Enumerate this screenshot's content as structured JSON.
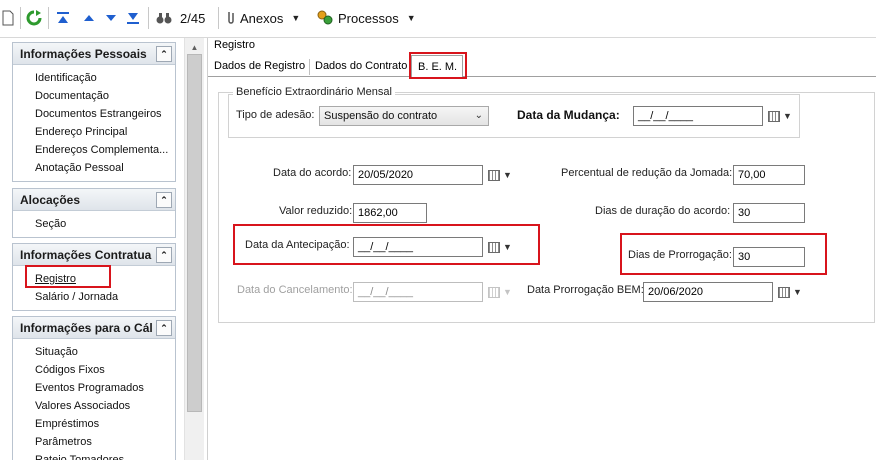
{
  "toolbar": {
    "counter": "2/45",
    "anexos_label": "Anexos",
    "processos_label": "Processos",
    "colors": {
      "green": "#2e9a2e",
      "blue": "#1f5fcf"
    }
  },
  "sidebar": {
    "sections": [
      {
        "title": "Informações Pessoais",
        "items": [
          "Identificação",
          "Documentação",
          "Documentos Estrangeiros",
          "Endereço Principal",
          "Endereços Complementa...",
          "Anotação Pessoal"
        ]
      },
      {
        "title": "Alocações",
        "items": [
          "Seção"
        ]
      },
      {
        "title": "Informações Contratua",
        "items": [
          "Registro",
          "Salário / Jornada"
        ]
      },
      {
        "title": "Informações para o Cál",
        "items": [
          "Situação",
          "Códigos Fixos",
          "Eventos Programados",
          "Valores Associados",
          "Empréstimos",
          "Parâmetros",
          "Rateio Tomadores"
        ]
      }
    ],
    "toggle_glyph": "⌃"
  },
  "main": {
    "breadcrumb": "Registro",
    "tabs": [
      "Dados de Registro",
      "Dados do Contrato",
      "B. E. M."
    ],
    "fieldset_legend": "Benefício Extraordinário Mensal",
    "tipo_adesao_label": "Tipo de adesão:",
    "tipo_adesao_value": "Suspensão do contrato",
    "data_mudanca_label": "Data da Mudança:",
    "data_mudanca_value": "__/__/____",
    "data_acordo_label": "Data do acordo:",
    "data_acordo_value": "20/05/2020",
    "percentual_label": "Percentual de redução da Jomada:",
    "percentual_value": "70,00",
    "valor_reduzido_label": "Valor reduzido:",
    "valor_reduzido_value": "1862,00",
    "dias_duracao_label": "Dias de duração do acordo:",
    "dias_duracao_value": "30",
    "data_antecipacao_label": "Data da Antecipação:",
    "data_antecipacao_value": "__/__/____",
    "dias_prorrogacao_label": "Dias de Prorrogação:",
    "dias_prorrogacao_value": "30",
    "data_cancelamento_label": "Data do Cancelamento:",
    "data_cancelamento_value": "__/__/____",
    "data_prorrogacao_label": "Data Prorrogação BEM:",
    "data_prorrogacao_value": "20/06/2020"
  },
  "highlight_color": "#d8141c"
}
